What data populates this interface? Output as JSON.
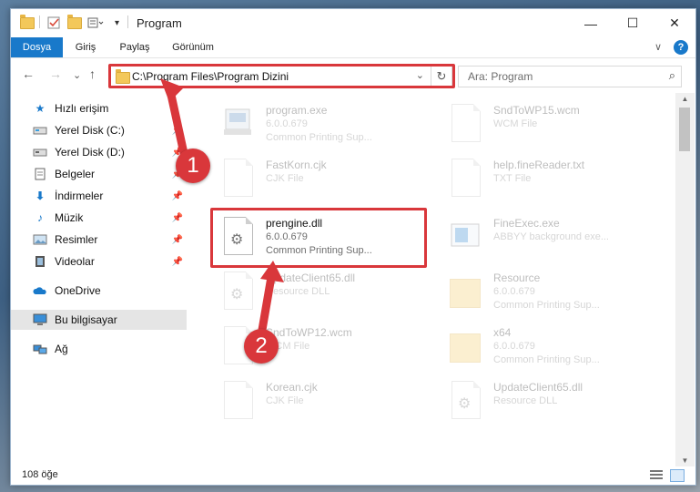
{
  "window": {
    "title": "Program",
    "minimize": "—",
    "maximize": "☐",
    "close": "✕"
  },
  "ribbon": {
    "tabs": [
      "Dosya",
      "Giriş",
      "Paylaş",
      "Görünüm"
    ],
    "chevron": "∨",
    "help": "?"
  },
  "nav": {
    "back": "←",
    "forward": "→",
    "recent": "⌄",
    "up": "↑"
  },
  "address": {
    "path": "C:\\Program Files\\Program Dizini",
    "refresh": "↻",
    "dropdown": "⌄"
  },
  "search": {
    "placeholder": "Ara: Program",
    "icon": "⌕"
  },
  "sidebar": {
    "items": [
      {
        "label": "Hızlı erişim",
        "icon": "star-icon"
      },
      {
        "label": "Yerel Disk (C:)",
        "icon": "drive-icon"
      },
      {
        "label": "Yerel Disk (D:)",
        "icon": "drive-icon"
      },
      {
        "label": "Belgeler",
        "icon": "documents-icon"
      },
      {
        "label": "İndirmeler",
        "icon": "download-icon"
      },
      {
        "label": "Müzik",
        "icon": "music-icon"
      },
      {
        "label": "Resimler",
        "icon": "pictures-icon"
      },
      {
        "label": "Videolar",
        "icon": "video-icon"
      },
      {
        "label": "OneDrive",
        "icon": "cloud-icon"
      },
      {
        "label": "Bu bilgisayar",
        "icon": "computer-icon"
      },
      {
        "label": "Ağ",
        "icon": "network-icon"
      }
    ]
  },
  "files": [
    {
      "name": "program.exe",
      "line2": "6.0.0.679",
      "line3": "Common Printing Sup..."
    },
    {
      "name": "SndToWP15.wcm",
      "line2": "WCM File",
      "line3": ""
    },
    {
      "name": "FastKorn.cjk",
      "line2": "CJK File",
      "line3": ""
    },
    {
      "name": "help.fineReader.txt",
      "line2": "TXT File",
      "line3": ""
    },
    {
      "name": "prengine.dll",
      "line2": "6.0.0.679",
      "line3": "Common Printing Sup..."
    },
    {
      "name": "FineExec.exe",
      "line2": "ABBYY background exe...",
      "line3": ""
    },
    {
      "name": "UpdateClient65.dll",
      "line2": "Resource DLL",
      "line3": ""
    },
    {
      "name": "Resource",
      "line2": "6.0.0.679",
      "line3": "Common Printing Sup..."
    },
    {
      "name": "SndToWP12.wcm",
      "line2": "WCM File",
      "line3": ""
    },
    {
      "name": "x64",
      "line2": "6.0.0.679",
      "line3": "Common Printing Sup..."
    },
    {
      "name": "Korean.cjk",
      "line2": "CJK File",
      "line3": ""
    },
    {
      "name": "UpdateClient65.dll",
      "line2": "Resource DLL",
      "line3": ""
    }
  ],
  "status": {
    "count": "108 öğe"
  },
  "annotations": {
    "step1": "1",
    "step2": "2"
  },
  "colors": {
    "highlight": "#d9373b",
    "accent": "#1979ca"
  }
}
